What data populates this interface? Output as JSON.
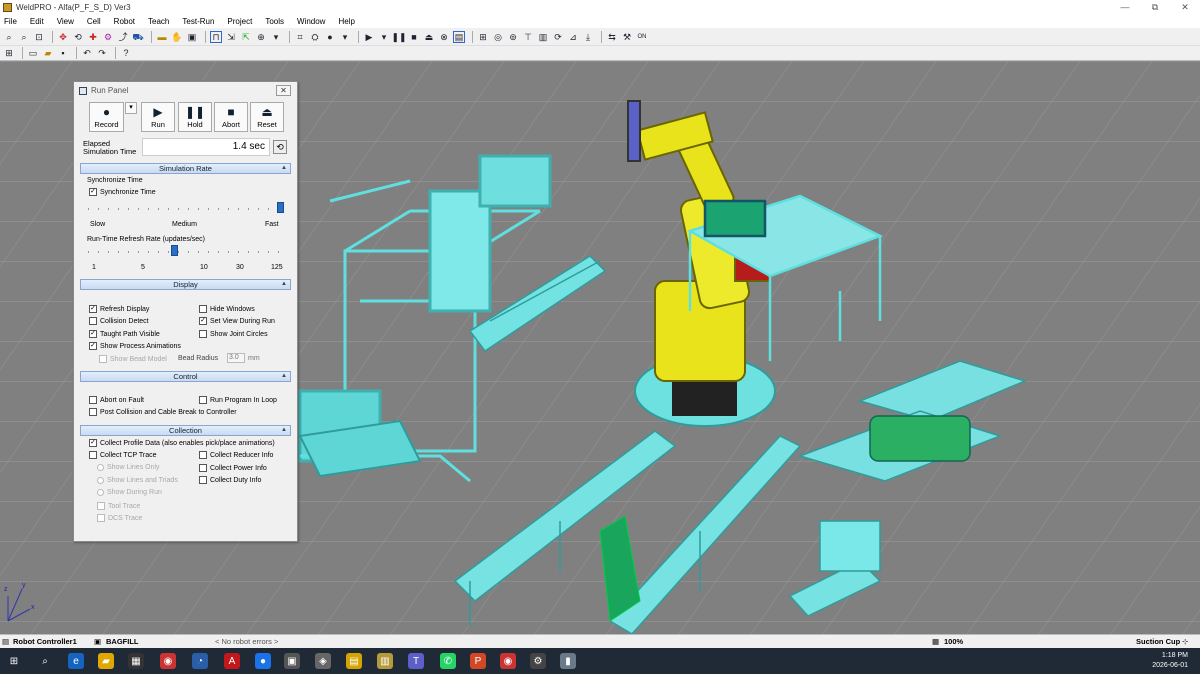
{
  "window": {
    "title": "WeldPRO - Alfa(P_F_S_D) Ver3",
    "minimize_glyph": "—",
    "maximize_glyph": "⧉",
    "close_glyph": "✕"
  },
  "menu": [
    "File",
    "Edit",
    "View",
    "Cell",
    "Robot",
    "Teach",
    "Test-Run",
    "Project",
    "Tools",
    "Window",
    "Help"
  ],
  "toolbar1_icons": [
    "zoom-icon",
    "zoom-area-icon",
    "zoom-fit-icon",
    "pan-icon",
    "rotate-icon",
    "tool-icon",
    "robot-icon",
    "path-icon",
    "cart-icon",
    "camera-icon",
    "hand-icon",
    "snapshot-icon",
    "view-icon",
    "move-icon",
    "teach-icon",
    "point-icon",
    "record-icon",
    "play-icon",
    "step-icon",
    "pause-icon",
    "stop-icon",
    "eject-icon",
    "cancel-icon",
    "panel-icon",
    "grid-icon",
    "frame-icon",
    "target-icon",
    "measure-icon",
    "weld-icon",
    "online-icon"
  ],
  "toolbar2_icons": [
    "grid-icon",
    "new-icon",
    "open-icon",
    "save-icon",
    "undo-icon",
    "redo-icon",
    "help-icon"
  ],
  "run_panel": {
    "title": "Run Panel",
    "close_glyph": "✕",
    "buttons": {
      "record": "Record",
      "run": "Run",
      "hold": "Hold",
      "abort": "Abort",
      "reset": "Reset"
    },
    "dropdown_glyph": "▾",
    "elapsed_label": "Elapsed Simulation Time",
    "elapsed_value": "1.4 sec",
    "simulation_rate": {
      "header": "Simulation Rate",
      "sync_group": "Synchronize Time",
      "sync_checkbox": "Synchronize Time",
      "sync_checked": true,
      "speed_labels": {
        "slow": "Slow",
        "medium": "Medium",
        "fast": "Fast"
      },
      "speed_level": 1.0,
      "refresh_label": "Run-Time Refresh Rate (updates/sec)",
      "refresh_ticks": [
        "1",
        "5",
        "10",
        "30",
        "125"
      ],
      "refresh_level": 0.44
    },
    "display": {
      "header": "Display",
      "options": [
        {
          "label": "Refresh Display",
          "checked": true
        },
        {
          "label": "Collision Detect",
          "checked": false
        },
        {
          "label": "Taught Path Visible",
          "checked": true
        },
        {
          "label": "Show Process Animations",
          "checked": true
        },
        {
          "label": "Hide Windows",
          "checked": false
        },
        {
          "label": "Set View During Run",
          "checked": true
        },
        {
          "label": "Show Joint Circles",
          "checked": false
        },
        {
          "label": "Show Bead Model",
          "checked": false
        }
      ],
      "bead_radius_label": "Bead Radius",
      "bead_radius_value": "3.0",
      "bead_radius_unit": "mm"
    },
    "control": {
      "header": "Control",
      "options": [
        {
          "label": "Abort on Fault",
          "checked": false
        },
        {
          "label": "Post Collision and Cable Break to Controller",
          "checked": false
        },
        {
          "label": "Run Program In Loop",
          "checked": false
        }
      ]
    },
    "collection": {
      "header": "Collection",
      "options": [
        {
          "label": "Collect Profile Data (also enables pick/place animations)",
          "checked": true
        },
        {
          "label": "Collect TCP Trace",
          "checked": false
        },
        {
          "label": "Collect Reducer Info",
          "checked": false
        },
        {
          "label": "Collect Power Info",
          "checked": false
        },
        {
          "label": "Collect Duty Info",
          "checked": false
        }
      ],
      "radios": [
        "Show Lines Only",
        "Show Lines and Triads",
        "Show During Run"
      ],
      "disabled_options": [
        "Tool Trace",
        "DCS Trace"
      ]
    }
  },
  "statusbar": {
    "controller": "Robot Controller1",
    "program": "BAGFILL",
    "errors": "< No robot errors >",
    "zoom": "100%",
    "tool": "Suction Cup"
  },
  "axis_labels": {
    "x": "x",
    "y": "y",
    "z": "z"
  },
  "taskbar": {
    "time": "1:18 PM",
    "date": "2026-06-01",
    "apps": [
      "windows-icon",
      "search-icon",
      "taskview-icon",
      "edge-icon",
      "files-icon",
      "store-icon",
      "chrome-icon",
      "app-icon",
      "acrobat-icon",
      "app2-icon",
      "app3-icon",
      "app4-icon",
      "app5-icon",
      "app6-icon",
      "teams-icon",
      "whatsapp-icon",
      "powerpoint-icon",
      "chrome2-icon",
      "roboguide-icon",
      "app7-icon"
    ]
  }
}
